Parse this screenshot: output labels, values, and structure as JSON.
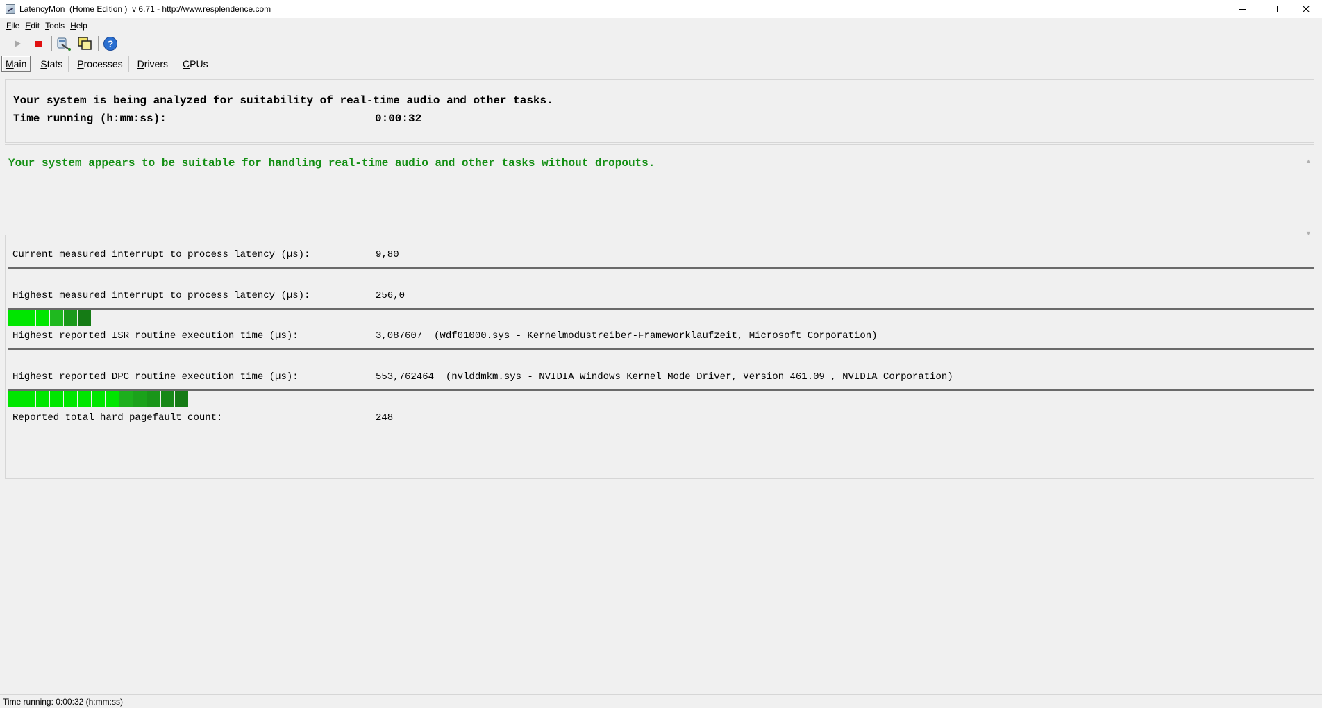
{
  "window": {
    "title": "LatencyMon  (Home Edition )  v 6.71 - http://www.resplendence.com",
    "minimize_icon": "minimize-icon",
    "maximize_icon": "maximize-icon",
    "close_icon": "close-icon"
  },
  "menu": [
    {
      "label": "File",
      "key": "F",
      "rest": "ile"
    },
    {
      "label": "Edit",
      "key": "E",
      "rest": "dit"
    },
    {
      "label": "Tools",
      "key": "T",
      "rest": "ools"
    },
    {
      "label": "Help",
      "key": "H",
      "rest": "elp"
    }
  ],
  "toolbar": {
    "start_icon": "play-icon",
    "stop_icon": "stop-icon",
    "driver_icon": "driver-icon",
    "windows_icon": "windows-icon",
    "help_icon": "help-icon"
  },
  "tabs": [
    {
      "key": "M",
      "rest": "ain",
      "active": true
    },
    {
      "key": "S",
      "rest": "tats"
    },
    {
      "key": "P",
      "rest": "rocesses"
    },
    {
      "key": "D",
      "rest": "rivers"
    },
    {
      "key": "C",
      "rest": "PUs"
    }
  ],
  "analysis": {
    "heading": "Your system is being analyzed for suitability of real-time audio and other tasks.",
    "time_label": "Time running (h:mm:ss):",
    "time_value": "0:00:32"
  },
  "verdict": {
    "text": "Your system appears to be suitable for handling real-time audio and other tasks without dropouts.",
    "color": "#148f14"
  },
  "stats": {
    "current_latency": {
      "label": "Current measured interrupt to process latency (µs):",
      "value": "9,80",
      "bar_segments": 0
    },
    "highest_latency": {
      "label": "Highest measured interrupt to process latency (µs):",
      "value": "256,0",
      "bar_segments": 6
    },
    "highest_isr": {
      "label": "Highest reported ISR routine execution time (µs):",
      "value": "3,087607  (Wdf01000.sys - Kernelmodustreiber-Frameworklaufzeit, Microsoft Corporation)",
      "bar_segments": 0
    },
    "highest_dpc": {
      "label": "Highest reported DPC routine execution time (µs):",
      "value": "553,762464  (nvlddmkm.sys - NVIDIA Windows Kernel Mode Driver, Version 461.09 , NVIDIA Corporation)",
      "bar_segments": 13
    },
    "pagefaults": {
      "label": "Reported total hard pagefault count:",
      "value": "248"
    }
  },
  "colors": {
    "bar_green": "#00e600",
    "bar_dark_green": "#1a9a1a"
  },
  "statusbar": {
    "text": "Time running: 0:00:32  (h:mm:ss)"
  }
}
